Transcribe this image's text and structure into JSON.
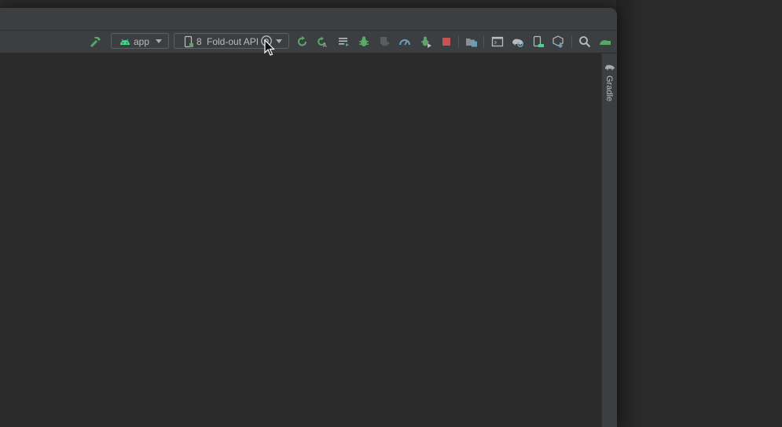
{
  "toolbar": {
    "run_config": {
      "label": "app"
    },
    "device_selector": {
      "index": "8",
      "label": "Fold-out API"
    }
  },
  "right_panel": {
    "gradle_label": "Gradle"
  },
  "icons": {
    "build": "hammer-icon",
    "android": "android-icon",
    "device": "phone-icon",
    "settings": "gear-icon",
    "rerun": "rerun-icon",
    "apply_changes": "apply-changes-icon",
    "apply_code": "apply-code-icon",
    "debug": "debug-icon",
    "coverage": "coverage-icon",
    "profile": "profile-icon",
    "attach_debugger": "attach-debugger-icon",
    "stop": "stop-icon",
    "project_structure": "project-structure-icon",
    "terminal": "terminal-icon",
    "sync_gradle": "sync-gradle-icon",
    "avd_manager": "avd-manager-icon",
    "sdk_manager": "sdk-manager-icon",
    "search": "search-icon",
    "elephant": "gradle-elephant-icon"
  },
  "colors": {
    "android_green": "#3ddc84",
    "build_green": "#59a869",
    "stop_red": "#c75450",
    "tool_blue": "#6a9fb5"
  }
}
